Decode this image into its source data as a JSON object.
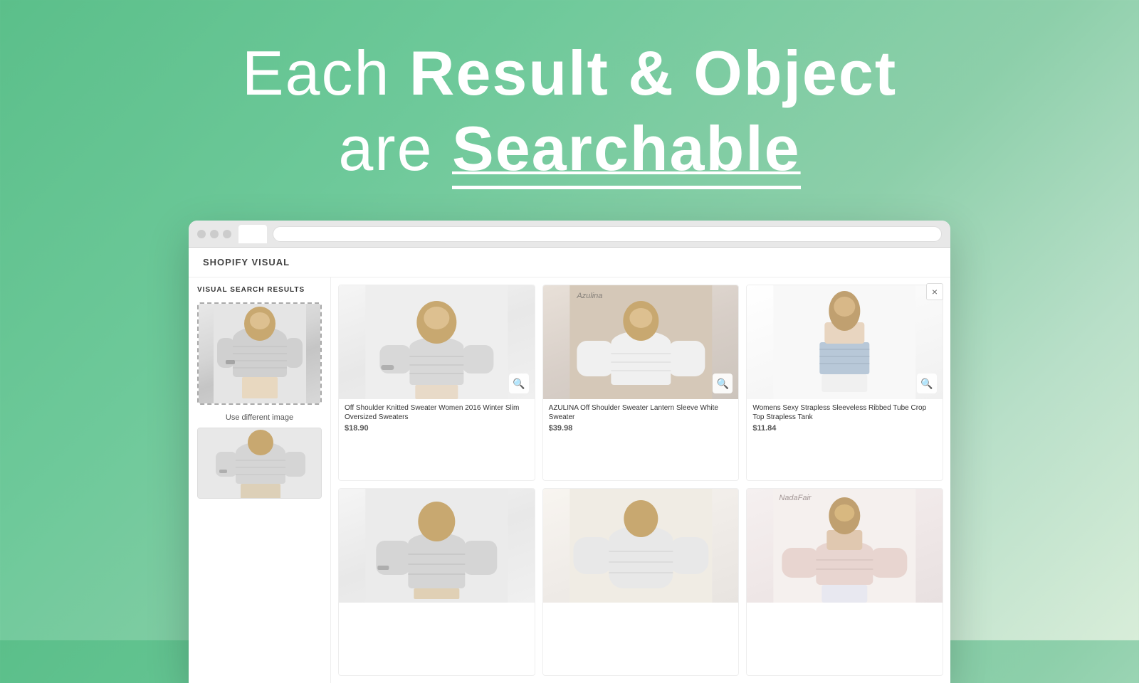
{
  "headline": {
    "line1_normal": "Each ",
    "line1_bold": "Result & Object",
    "line2_normal": "are ",
    "line2_bold": "Searchable"
  },
  "browser": {
    "store_name": "SHOPIFY VISUAL",
    "close_button": "×",
    "panel_title": "VISUAL SEARCH RESULTS",
    "use_different_label": "Use different image"
  },
  "products": [
    {
      "name": "Off Shoulder Knitted Sweater Women 2016 Winter Slim Oversized Sweaters",
      "price": "$18.90",
      "bg_class": "bg-light-gray",
      "has_watermark": false
    },
    {
      "name": "AZULINA Off Shoulder Sweater Lantern Sleeve White Sweater",
      "price": "$39.98",
      "bg_class": "bg-warm-gray",
      "has_watermark": true,
      "watermark": "Azulina"
    },
    {
      "name": "Womens Sexy Strapless Sleeveless Ribbed Tube Crop Top Strapless Tank",
      "price": "$11.84",
      "bg_class": "bg-white-bright",
      "has_watermark": false
    },
    {
      "name": "",
      "price": "",
      "bg_class": "bg-light-gray",
      "has_watermark": false
    },
    {
      "name": "",
      "price": "",
      "bg_class": "bg-cream",
      "has_watermark": false
    },
    {
      "name": "",
      "price": "",
      "bg_class": "bg-soft-pink",
      "has_watermark": true,
      "watermark": "NadaFair"
    }
  ]
}
